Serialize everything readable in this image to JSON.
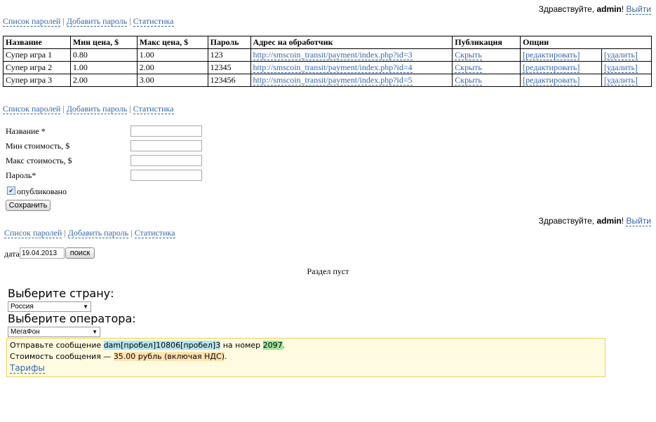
{
  "header": {
    "greeting": "Здравствуйте, ",
    "user": "admin",
    "excl": "!",
    "logout": "Выйти"
  },
  "nav": {
    "list": "Список паролей",
    "add": "Добавить пароль",
    "stats": "Статистика",
    "sep": "|"
  },
  "table": {
    "columns": [
      "Название",
      "Мин цена, $",
      "Макс цена, $",
      "Пароль",
      "Адрес на обработчик",
      "Публикация",
      "Опции"
    ],
    "rows": [
      {
        "name": "Супер игра 1",
        "min": "0.80",
        "max": "1.00",
        "password": "123",
        "url": "http://smscoin_transit/payment/index.php?id=3",
        "publish": "Скрыть",
        "edit": "[редактировать]",
        "delete": "[удалить]"
      },
      {
        "name": "Супер игра 2",
        "min": "1.00",
        "max": "2.00",
        "password": "12345",
        "url": "http://smscoin_transit/payment/index.php?id=4",
        "publish": "Скрыть",
        "edit": "[редактировать]",
        "delete": "[удалить]"
      },
      {
        "name": "Супер игра 3",
        "min": "2.00",
        "max": "3.00",
        "password": "123456",
        "url": "http://smscoin_transit/payment/index.php?id=5",
        "publish": "Скрыть",
        "edit": "[редактировать]",
        "delete": "[удалить]"
      }
    ]
  },
  "form": {
    "name_label": "Название *",
    "min_label": "Мин стоимость, $",
    "max_label": "Макс стоимость, $",
    "password_label": "Пароль*",
    "published_label": "опубликовано",
    "published_checked": true,
    "save_label": "Сохранить"
  },
  "stats": {
    "date_label": "дата",
    "date_value": "19.04.2013",
    "search_label": "поиск",
    "empty_text": "Раздел пуст"
  },
  "sms": {
    "country_heading": "Выберите страну:",
    "country_value": "Россия",
    "operator_heading": "Выберите оператора:",
    "operator_value": "МегаФон",
    "send_text": "Отправьте сообщение",
    "message_code": "dam[пробел]10806[пробел]3",
    "to_number_text": "на номер",
    "number": "2097",
    "period": ".",
    "cost_text": "Стоимость сообщения —",
    "cost_value": "35.00 рубль (включая НДС)",
    "cost_period": ".",
    "tariffs_link": "Тарифы"
  }
}
